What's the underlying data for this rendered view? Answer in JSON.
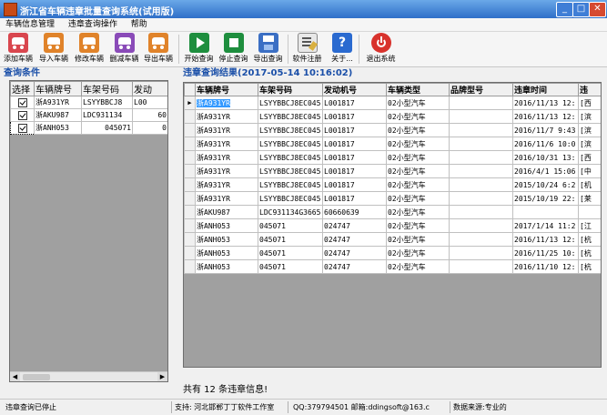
{
  "window": {
    "title": "浙江省车辆违章批量查询系统(试用版)",
    "minimize": "_",
    "maximize": "□",
    "close": "✕"
  },
  "menu": [
    "车辆信息管理",
    "违章查询操作",
    "帮助"
  ],
  "toolbar": {
    "add_car": "添加车辆",
    "import_car": "导入车辆",
    "edit_car": "修改车辆",
    "delete_car": "删减车辆",
    "export_car": "导出车辆",
    "start_query": "开始查询",
    "stop_query": "停止查询",
    "export_query": "导出查询",
    "register": "软件注册",
    "about": "关于...",
    "exit": "退出系统"
  },
  "left_panel": {
    "title": "查询条件",
    "headers": [
      "选择",
      "车辆牌号",
      "车架号码",
      "发动"
    ],
    "rows": [
      {
        "checked": true,
        "plate": "浙A931YR",
        "vin": "LSYYBBCJ8",
        "engine": "L00"
      },
      {
        "checked": true,
        "plate": "浙AKU987",
        "vin": "LDC931134",
        "engine": "60"
      },
      {
        "checked": true,
        "plate": "浙ANH053",
        "vin": "045071",
        "engine": "0"
      }
    ]
  },
  "right_panel": {
    "title": "违章查询结果(2017-05-14 10:16:02)",
    "headers": [
      "车辆牌号",
      "车架号码",
      "发动机号",
      "车辆类型",
      "品牌型号",
      "违章时间",
      "违"
    ],
    "rows": [
      [
        "浙A931YR",
        "LSYYBBCJ8EC045",
        "L001817",
        "02小型汽车",
        "",
        "2016/11/13 12:",
        "[西"
      ],
      [
        "浙A931YR",
        "LSYYBBCJ8EC045",
        "L001817",
        "02小型汽车",
        "",
        "2016/11/13 12:",
        "[滨"
      ],
      [
        "浙A931YR",
        "LSYYBBCJ8EC045",
        "L001817",
        "02小型汽车",
        "",
        "2016/11/7 9:43",
        "[滨"
      ],
      [
        "浙A931YR",
        "LSYYBBCJ8EC045",
        "L001817",
        "02小型汽车",
        "",
        "2016/11/6 10:0",
        "[滨"
      ],
      [
        "浙A931YR",
        "LSYYBBCJ8EC045",
        "L001817",
        "02小型汽车",
        "",
        "2016/10/31 13:",
        "[西"
      ],
      [
        "浙A931YR",
        "LSYYBBCJ8EC045",
        "L001817",
        "02小型汽车",
        "",
        "2016/4/1 15:06",
        "[中"
      ],
      [
        "浙A931YR",
        "LSYYBBCJ8EC045",
        "L001817",
        "02小型汽车",
        "",
        "2015/10/24 6:2",
        "[机"
      ],
      [
        "浙A931YR",
        "LSYYBBCJ8EC045",
        "L001817",
        "02小型汽车",
        "",
        "2015/10/19 22:",
        "[莱"
      ],
      [
        "浙AKU987",
        "LDC931134G3665",
        "60660639",
        "02小型汽车",
        "",
        "",
        ""
      ],
      [
        "浙ANH053",
        "045071",
        "024747",
        "02小型汽车",
        "",
        "2017/1/14 11:2",
        "[江"
      ],
      [
        "浙ANH053",
        "045071",
        "024747",
        "02小型汽车",
        "",
        "2016/11/13 12:",
        "[杭"
      ],
      [
        "浙ANH053",
        "045071",
        "024747",
        "02小型汽车",
        "",
        "2016/11/25 10:",
        "[杭"
      ],
      [
        "浙ANH053",
        "045071",
        "024747",
        "02小型汽车",
        "",
        "2016/11/10 12:",
        "[杭"
      ]
    ],
    "summary": "共有 12 条违章信息!"
  },
  "status": {
    "state": "违章查询已停止",
    "support": "支持: 河北邯郸丁丁软件工作室",
    "contact": "QQ:379794501 邮箱:ddingsoft@163.c",
    "source": "数据来源:专业的"
  }
}
